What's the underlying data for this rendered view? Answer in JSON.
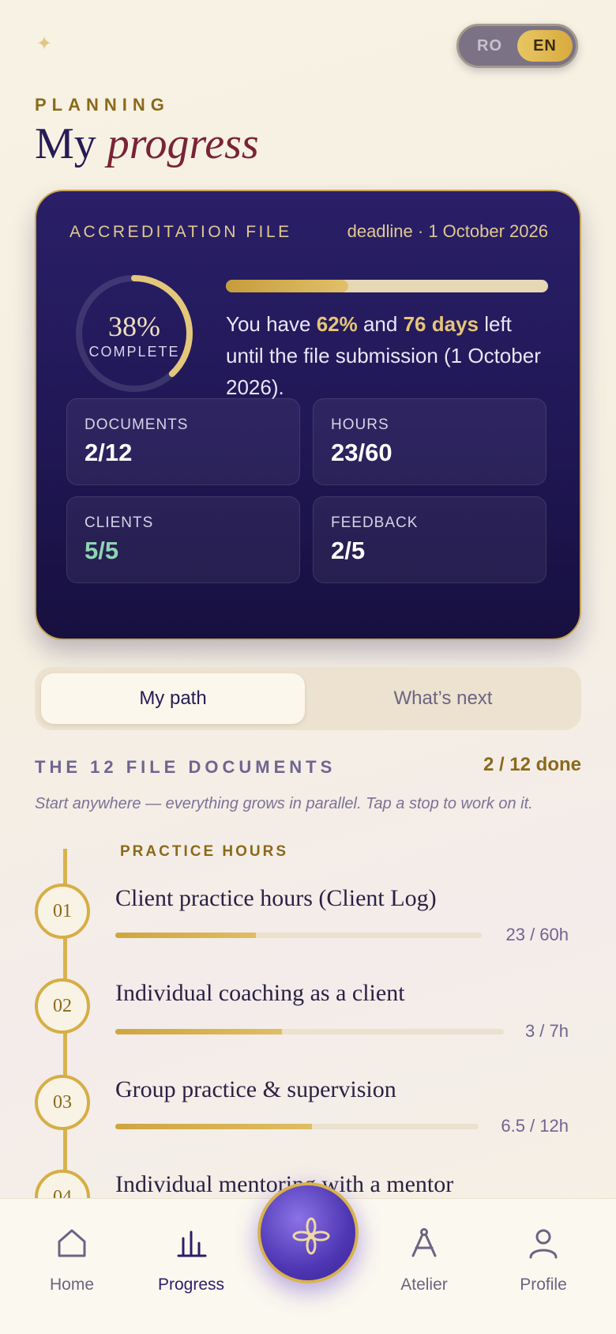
{
  "header": {
    "sparkle_icon": "sparkle-icon",
    "lang": {
      "ro": "RO",
      "en": "EN",
      "selected": "EN"
    },
    "eyebrow": "PLANNING",
    "title_plain": "My",
    "title_accent": "progress"
  },
  "card": {
    "label": "ACCREDITATION FILE",
    "deadline": "deadline · 1 October 2026",
    "ring_percent_text": "38%",
    "ring_percent": 38,
    "ring_sub": "COMPLETE",
    "bar_percent": 38,
    "msg_prefix": "You have ",
    "msg_pct": "62%",
    "msg_mid": " and ",
    "msg_days": "76 days",
    "msg_suffix": " left until the file submission (1 October 2026).",
    "stats": [
      {
        "label": "DOCUMENTS",
        "value": "2/12",
        "color": "#ffffff"
      },
      {
        "label": "HOURS",
        "value": "23/60",
        "color": "#ffffff"
      },
      {
        "label": "CLIENTS",
        "value": "5/5",
        "color": "#8fd4b4"
      },
      {
        "label": "FEEDBACK",
        "value": "2/5",
        "color": "#ffffff"
      }
    ]
  },
  "tabs": {
    "active": "My path",
    "idle": "What’s next"
  },
  "section": {
    "title": "THE 12 FILE DOCUMENTS",
    "count": "2 / 12 done",
    "hint": "Start anywhere — everything grows in parallel. Tap a stop to work on it.",
    "group_label": "PRACTICE HOURS",
    "steps": [
      {
        "num": "01",
        "title": "Client practice hours (Client Log)",
        "value": "23 / 60h",
        "progress": 0.383
      },
      {
        "num": "02",
        "title": "Individual coaching as a client",
        "value": "3 / 7h",
        "progress": 0.429
      },
      {
        "num": "03",
        "title": "Group practice & supervision",
        "value": "6.5 / 12h",
        "progress": 0.542
      },
      {
        "num": "04",
        "title": "Individual mentoring with a mentor",
        "value": "",
        "progress": 0
      }
    ]
  },
  "nav": {
    "home": "Home",
    "progress": "Progress",
    "atelier": "Atelier",
    "profile": "Profile",
    "active": "Progress"
  },
  "colors": {
    "brand": "#2a1f68",
    "gold": "#d6ae46",
    "accent": "#7a2336"
  }
}
